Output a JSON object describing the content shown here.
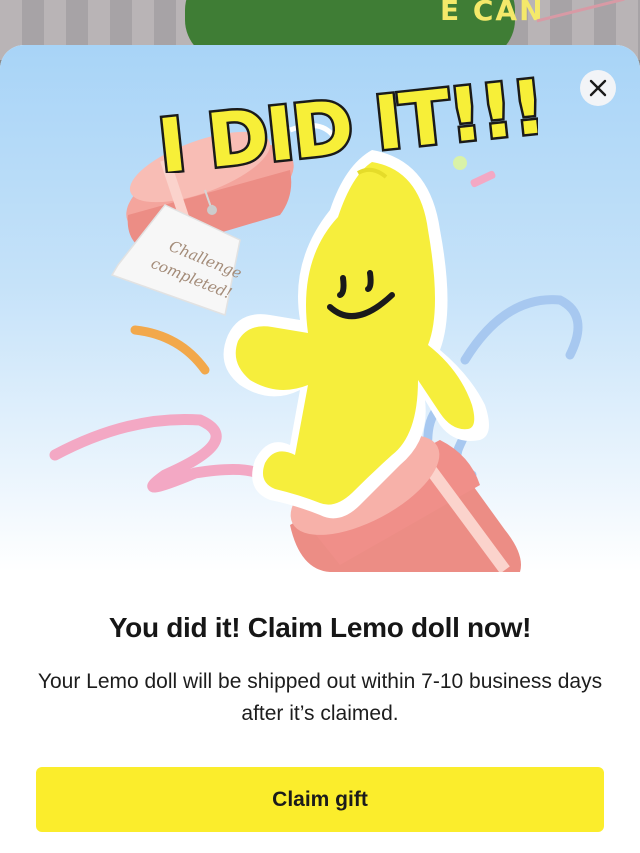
{
  "background": {
    "partial_label": "E CAN"
  },
  "modal": {
    "headline_art": "I DID IT!!!",
    "tag_text_line1": "Challenge",
    "tag_text_line2": "completed!",
    "close_icon": "close-icon",
    "title": "You did it! Claim Lemo doll now!",
    "description": "Your Lemo doll will be shipped out within 7-10 business days after it’s claimed.",
    "claim_button_label": "Claim gift"
  },
  "colors": {
    "accent_yellow": "#fbed2c",
    "doll_yellow": "#f6ee3c",
    "hero_sky": "#a8d4f7",
    "box_pink": "#ec8d85"
  }
}
